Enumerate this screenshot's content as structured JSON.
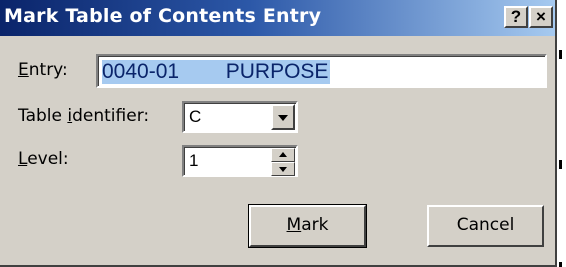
{
  "dialog": {
    "title": "Mark Table of Contents Entry",
    "help_button": "?",
    "close_button": "×"
  },
  "entry": {
    "label_mnemonic": "E",
    "label_rest": "ntry:",
    "value": "0040-01        PURPOSE"
  },
  "table_identifier": {
    "label_pre": "Table ",
    "label_mnemonic": "i",
    "label_post": "dentifier:",
    "value": "C"
  },
  "level": {
    "label_mnemonic": "L",
    "label_rest": "evel:",
    "value": "1"
  },
  "buttons": {
    "mark_mnemonic": "M",
    "mark_rest": "ark",
    "cancel": "Cancel"
  },
  "icons": {
    "dropdown": "chevron-down-icon",
    "spin_up": "spin-up-icon",
    "spin_down": "spin-down-icon"
  },
  "colors": {
    "title_gradient_start": "#0a246a",
    "title_gradient_end": "#a6caf0",
    "dialog_face": "#d4d0c8",
    "selection": "#a6caf0"
  }
}
